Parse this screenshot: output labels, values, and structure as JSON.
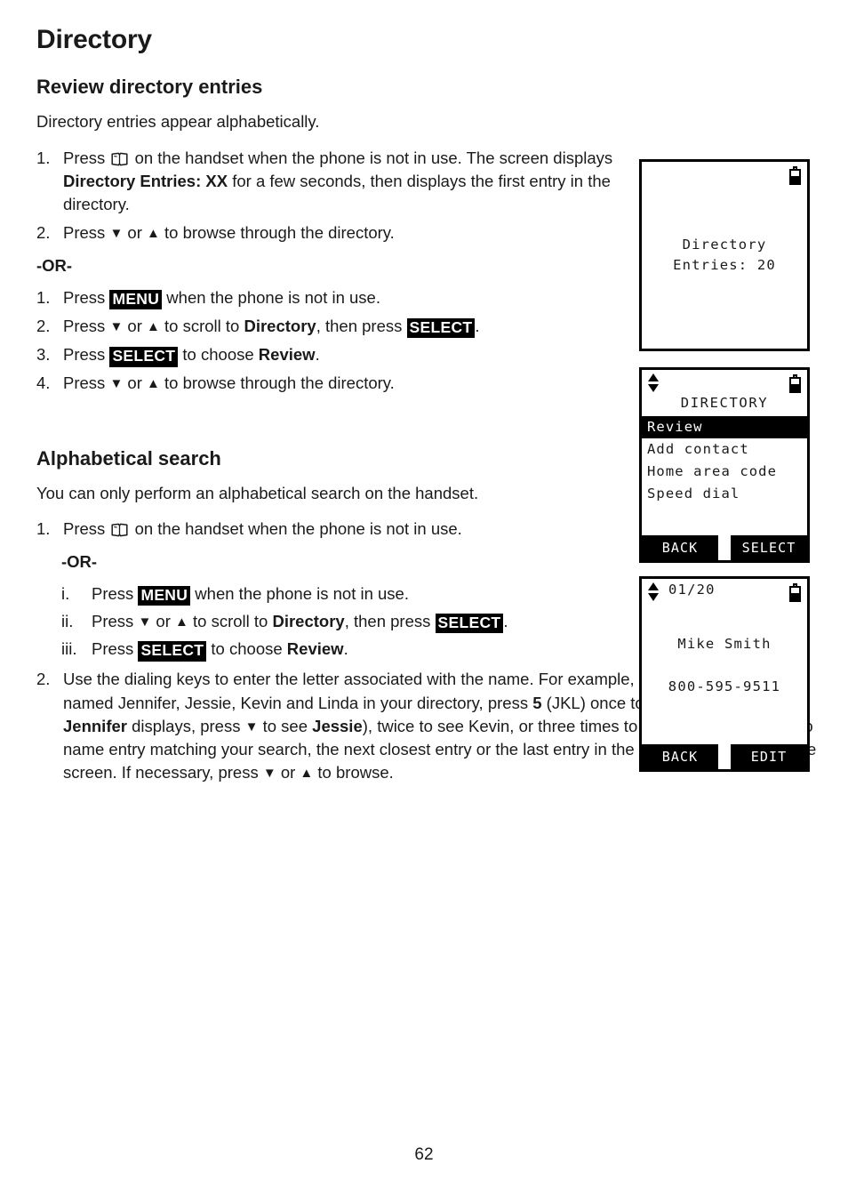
{
  "document": {
    "title": "Directory",
    "page_number": "62"
  },
  "sections": {
    "review": {
      "heading": "Review directory entries",
      "intro": "Directory entries appear alphabetically.",
      "steps_primary": [
        {
          "marker": "1.",
          "pre": "Press ",
          "icon": "directory-book-icon",
          "post_a": " on the handset when the phone is not in use. The screen displays ",
          "bold_a": "Directory Entries: XX",
          "post_b": " for a few seconds, then displays the first entry in the directory."
        },
        {
          "marker": "2.",
          "pre": "Press ",
          "arrow_down": "▼",
          "mid": " or ",
          "arrow_up": "▲",
          "post_a": " to browse through the directory."
        }
      ],
      "or_label": "-OR-",
      "steps_alt": [
        {
          "marker": "1.",
          "pre": "Press ",
          "key": "MENU",
          "post_a": " when the phone is not in use."
        },
        {
          "marker": "2.",
          "pre": "Press ",
          "arrow_down": "▼",
          "mid": " or ",
          "arrow_up": "▲",
          "post_a": " to scroll to ",
          "bold_a": "Directory",
          "post_b": ", then press ",
          "key": "SELECT",
          "post_c": "."
        },
        {
          "marker": "3.",
          "pre": "Press ",
          "key": "SELECT",
          "post_a": " to choose ",
          "bold_a": "Review",
          "post_b": "."
        },
        {
          "marker": "4.",
          "pre": "Press ",
          "arrow_down": "▼",
          "mid": " or ",
          "arrow_up": "▲",
          "post_a": " to browse through the directory."
        }
      ]
    },
    "alphabetical": {
      "heading": "Alphabetical search",
      "intro": "You can only perform an alphabetical search on the handset.",
      "step1": {
        "marker": "1.",
        "pre": "Press ",
        "icon": "directory-book-icon",
        "post_a": " on the handset when the phone is not in use."
      },
      "or_label": "-OR-",
      "steps_roman": [
        {
          "marker": "i.",
          "pre": "Press ",
          "key": "MENU",
          "post_a": " when the phone is not in use."
        },
        {
          "marker": "ii.",
          "pre": "Press ",
          "arrow_down": "▼",
          "mid": " or ",
          "arrow_up": "▲",
          "post_a": " to scroll to ",
          "bold_a": "Directory",
          "post_b": ", then press ",
          "key": "SELECT",
          "post_c": "."
        },
        {
          "marker": "iii.",
          "pre": "Press ",
          "key": "SELECT",
          "post_a": " to choose ",
          "bold_a": "Review",
          "post_b": "."
        }
      ],
      "step2": {
        "marker": "2.",
        "t1": "Use the dialing keys to enter the letter associated with the name. For example, if you have the entries named Jennifer, Jessie, Kevin and Linda in your directory, press ",
        "b1": "5",
        "t2": " (JKL) once to see Jennifer (when ",
        "b2": "Jennifer",
        "t3": " displays, press ",
        "arrow_down_1": "▼",
        "t4": " to see ",
        "b3": "Jessie",
        "t5": "), twice to see Kevin, or three times to see Linda. If there is no name entry matching your search, the next closest entry or the last entry in the directory displays on the screen. If necessary, press ",
        "arrow_down_2": "▼",
        "t6": " or ",
        "arrow_up_2": "▲",
        "t7": " to browse."
      }
    }
  },
  "lcd_screens": [
    {
      "id": "directory-entries-screen",
      "battery_icon": "battery-half-icon",
      "lines": [
        "Directory",
        "Entries: 20"
      ]
    },
    {
      "id": "directory-menu-screen",
      "scroll_icon": "scroll-up-down-icon",
      "battery_icon": "battery-half-icon",
      "title": "DIRECTORY",
      "menu_items": [
        {
          "label": "Review",
          "selected": true
        },
        {
          "label": "Add contact",
          "selected": false
        },
        {
          "label": "Home area code",
          "selected": false
        },
        {
          "label": "Speed dial",
          "selected": false
        }
      ],
      "softkeys": {
        "left": "BACK",
        "right": "SELECT"
      }
    },
    {
      "id": "directory-entry-screen",
      "scroll_icon": "scroll-up-down-icon",
      "battery_icon": "battery-half-icon",
      "index": "01/20",
      "name": "Mike Smith",
      "number": "800-595-9511",
      "softkeys": {
        "left": "BACK",
        "right": "EDIT"
      }
    }
  ],
  "colors": {
    "text": "#1a1a1a",
    "invert_bg": "#000000",
    "invert_fg": "#ffffff",
    "page_bg": "#ffffff"
  }
}
